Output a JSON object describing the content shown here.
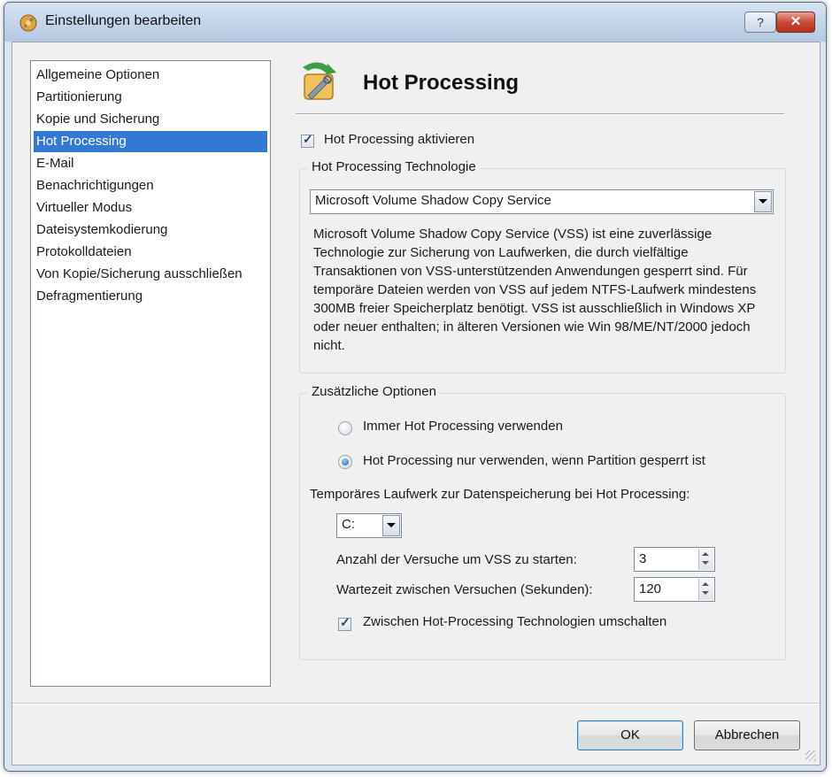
{
  "window": {
    "title": "Einstellungen bearbeiten",
    "help_label": "?",
    "close_label": "✕"
  },
  "nav": {
    "items": [
      "Allgemeine Optionen",
      "Partitionierung",
      "Kopie und Sicherung",
      "Hot Processing",
      "E-Mail",
      "Benachrichtigungen",
      "Virtueller Modus",
      "Dateisystemkodierung",
      "Protokolldateien",
      "Von Kopie/Sicherung ausschließen",
      "Defragmentierung"
    ],
    "selected_index": 3
  },
  "panel": {
    "title": "Hot Processing",
    "enable_checkbox": {
      "label": "Hot Processing aktivieren",
      "checked": true
    },
    "technology": {
      "legend": "Hot Processing Technologie",
      "selected": "Microsoft Volume Shadow Copy Service",
      "description": "Microsoft Volume Shadow Copy Service (VSS) ist eine zuverlässige Technologie zur Sicherung von Laufwerken, die durch vielfältige Transaktionen von VSS-unterstützenden Anwendungen gesperrt sind. Für temporäre Dateien werden von VSS auf jedem NTFS-Laufwerk mindestens 300MB freier Speicherplatz benötigt. VSS ist ausschließlich in Windows XP oder neuer enthalten; in älteren Versionen wie Win 98/ME/NT/2000 jedoch nicht."
    },
    "options": {
      "legend": "Zusätzliche Optionen",
      "radio_always": "Immer Hot Processing verwenden",
      "radio_locked": "Hot Processing nur verwenden, wenn Partition gesperrt ist",
      "selected_radio": "radio_locked",
      "temp_drive_label": "Temporäres Laufwerk zur Datenspeicherung bei Hot Processing:",
      "temp_drive_value": "C:",
      "attempts_label": "Anzahl der Versuche um VSS zu starten:",
      "attempts_value": "3",
      "wait_label": "Wartezeit zwischen Versuchen (Sekunden):",
      "wait_value": "120",
      "switch_checkbox": {
        "label": "Zwischen Hot-Processing Technologien umschalten",
        "checked": true
      }
    }
  },
  "buttons": {
    "ok": "OK",
    "cancel": "Abbrechen"
  }
}
